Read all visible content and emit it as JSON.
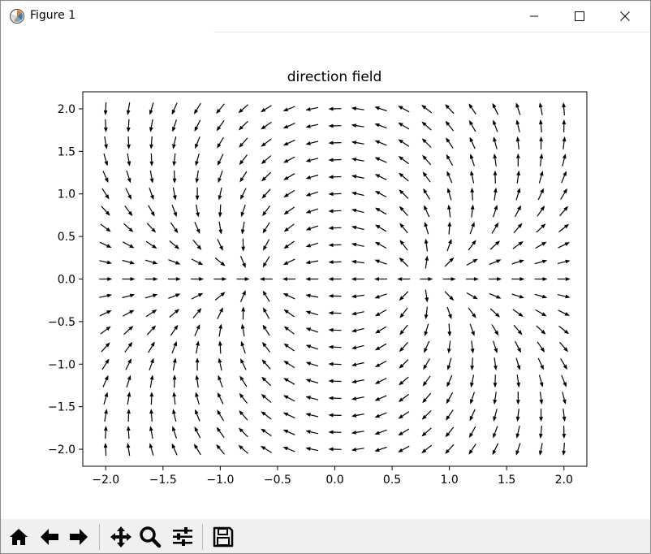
{
  "window": {
    "title": "Figure 1"
  },
  "toolbar": {
    "buttons": [
      "home-icon",
      "back-arrow-icon",
      "forward-arrow-icon",
      "pan-icon",
      "zoom-icon",
      "configure-subplots-icon",
      "save-icon"
    ]
  },
  "chart_data": {
    "type": "quiver",
    "title": "direction field",
    "xlabel": "",
    "ylabel": "",
    "xlim": [
      -2.2,
      2.2
    ],
    "ylim": [
      -2.2,
      2.2
    ],
    "grid": false,
    "xticks": [
      -2.0,
      -1.5,
      -1.0,
      -0.5,
      0.0,
      0.5,
      1.0,
      1.5,
      2.0
    ],
    "yticks": [
      -2.0,
      -1.5,
      -1.0,
      -0.5,
      0.0,
      0.5,
      1.0,
      1.5,
      2.0
    ],
    "xtick_labels": [
      "−2.0",
      "−1.5",
      "−1.0",
      "−0.5",
      "0.0",
      "0.5",
      "1.0",
      "1.5",
      "2.0"
    ],
    "ytick_labels": [
      "−2.0",
      "−1.5",
      "−1.0",
      "−0.5",
      "0.0",
      "0.5",
      "1.0",
      "1.5",
      "2.0"
    ],
    "grid_x": {
      "start": -2.0,
      "stop": 2.0,
      "count": 21
    },
    "grid_y": {
      "start": -2.0,
      "stop": 2.0,
      "count": 21
    },
    "field": {
      "description": "unit direction arrows of a vector field with two critical points",
      "sink": [
        -0.67,
        0.0
      ],
      "source": [
        0.73,
        0.0
      ]
    },
    "arrow_color": "#000000"
  }
}
